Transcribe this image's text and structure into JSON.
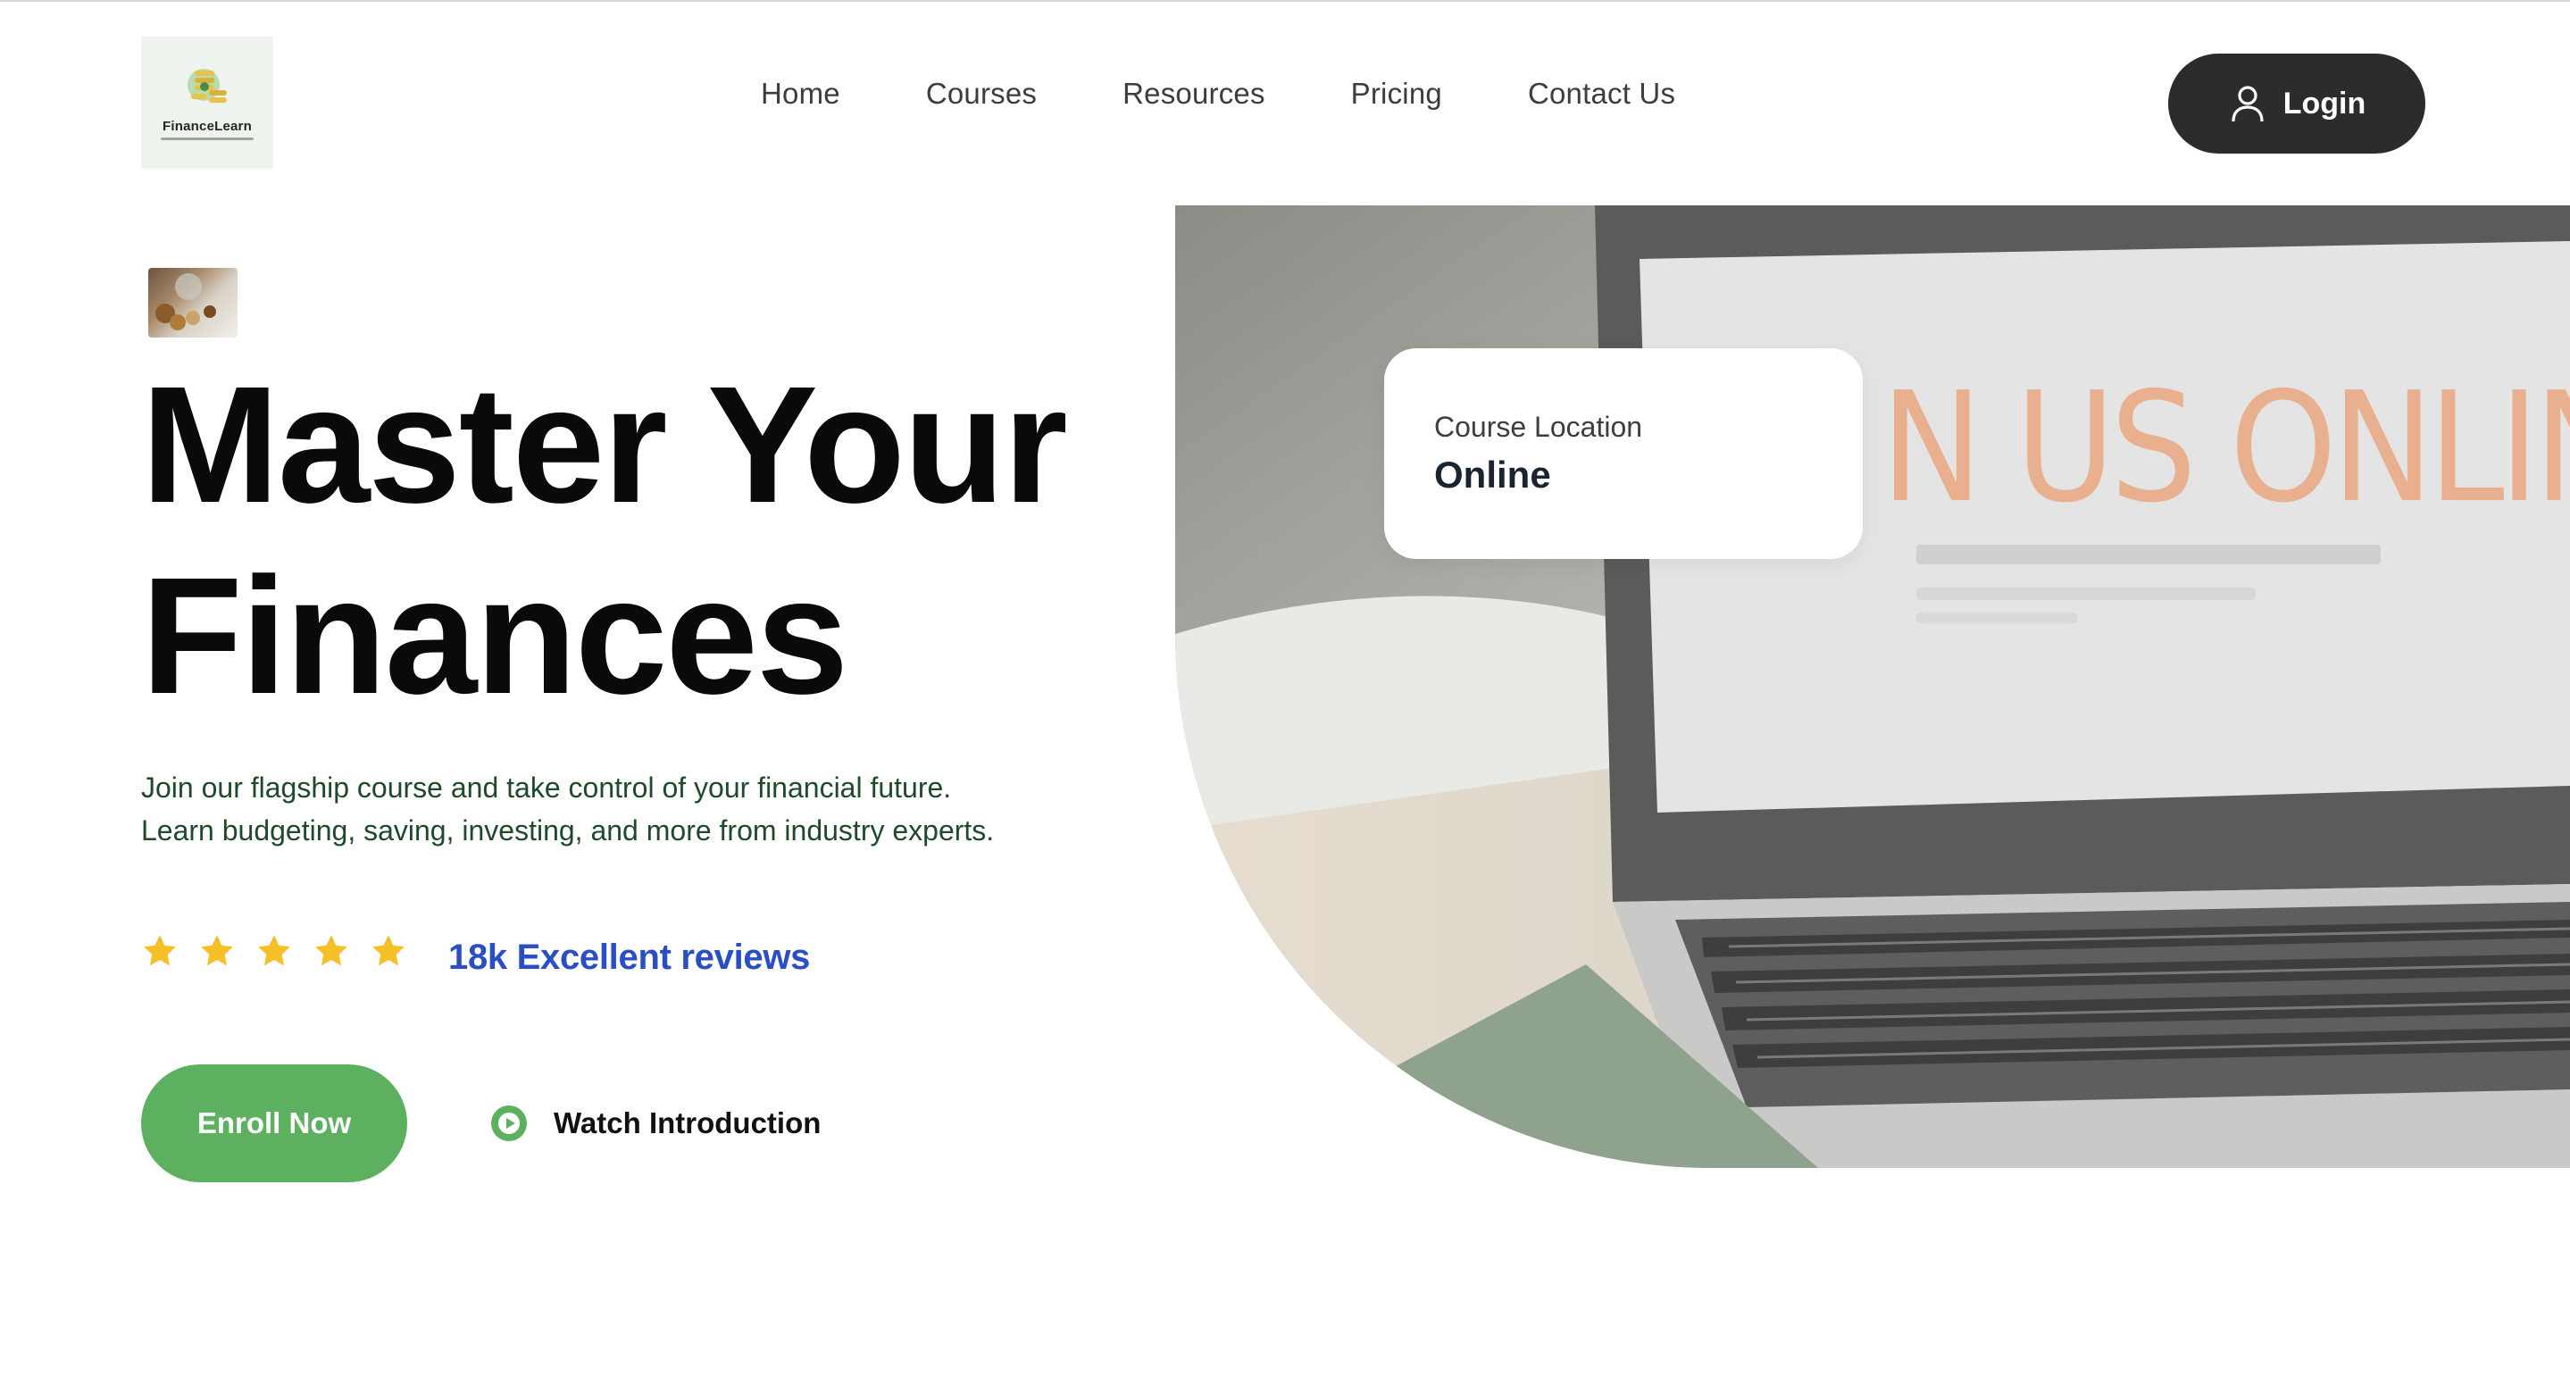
{
  "header": {
    "logo_text": "FinanceLearn",
    "nav": [
      "Home",
      "Courses",
      "Resources",
      "Pricing",
      "Contact Us"
    ],
    "login_label": "Login"
  },
  "hero": {
    "title_line1": "Master Your",
    "title_line2": "Finances",
    "description_line1": "Join our flagship course and take control of your financial future.",
    "description_line2": "Learn budgeting, saving, investing, and more from industry experts.",
    "rating_stars": 5,
    "reviews_text": "18k Excellent reviews",
    "enroll_label": "Enroll Now",
    "watch_label": "Watch Introduction"
  },
  "course_card": {
    "label": "Course Location",
    "value": "Online"
  },
  "screen_text": {
    "headline": "N US ONLINE."
  },
  "colors": {
    "accent_green": "#5cb060",
    "review_blue": "#2a4fc4",
    "star_yellow": "#f6bf2a",
    "login_bg": "#2a2d2a"
  }
}
